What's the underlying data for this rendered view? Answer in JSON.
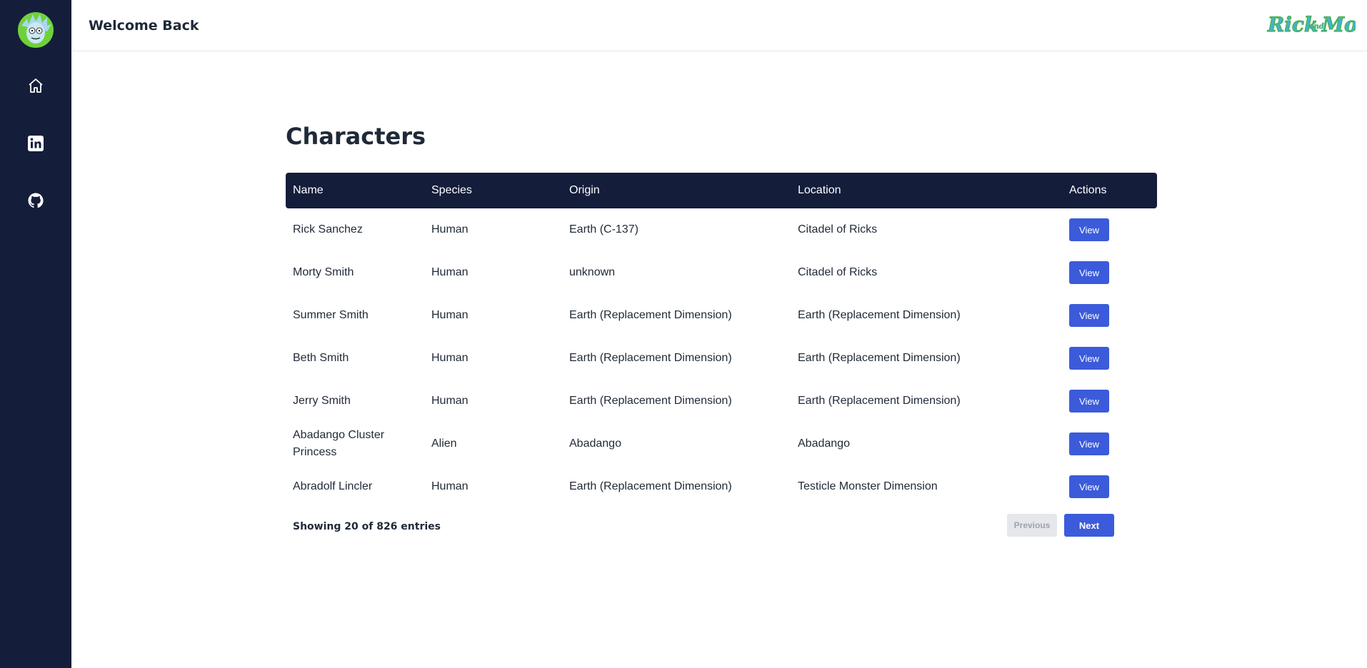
{
  "header": {
    "welcome": "Welcome Back"
  },
  "sidebar": {
    "items": [
      {
        "icon": "home-icon"
      },
      {
        "icon": "linkedin-icon"
      },
      {
        "icon": "github-icon"
      }
    ]
  },
  "main": {
    "title": "Characters",
    "columns": [
      "Name",
      "Species",
      "Origin",
      "Location",
      "Actions"
    ],
    "rows": [
      {
        "name": "Rick Sanchez",
        "species": "Human",
        "origin": "Earth (C-137)",
        "location": "Citadel of Ricks",
        "action": "View"
      },
      {
        "name": "Morty Smith",
        "species": "Human",
        "origin": "unknown",
        "location": "Citadel of Ricks",
        "action": "View"
      },
      {
        "name": "Summer Smith",
        "species": "Human",
        "origin": "Earth (Replacement Dimension)",
        "location": "Earth (Replacement Dimension)",
        "action": "View"
      },
      {
        "name": "Beth Smith",
        "species": "Human",
        "origin": "Earth (Replacement Dimension)",
        "location": "Earth (Replacement Dimension)",
        "action": "View"
      },
      {
        "name": "Jerry Smith",
        "species": "Human",
        "origin": "Earth (Replacement Dimension)",
        "location": "Earth (Replacement Dimension)",
        "action": "View"
      },
      {
        "name": "Abadango Cluster Princess",
        "species": "Alien",
        "origin": "Abadango",
        "location": "Abadango",
        "action": "View"
      },
      {
        "name": "Abradolf Lincler",
        "species": "Human",
        "origin": "Earth (Replacement Dimension)",
        "location": "Testicle Monster Dimension",
        "action": "View"
      }
    ],
    "pagination": {
      "summary": "Showing 20 of 826 entries",
      "previous": "Previous",
      "next": "Next"
    }
  },
  "colors": {
    "sidebar": "#141d3a",
    "accent": "#3b5bdb",
    "brand_green": "#4caf50"
  }
}
